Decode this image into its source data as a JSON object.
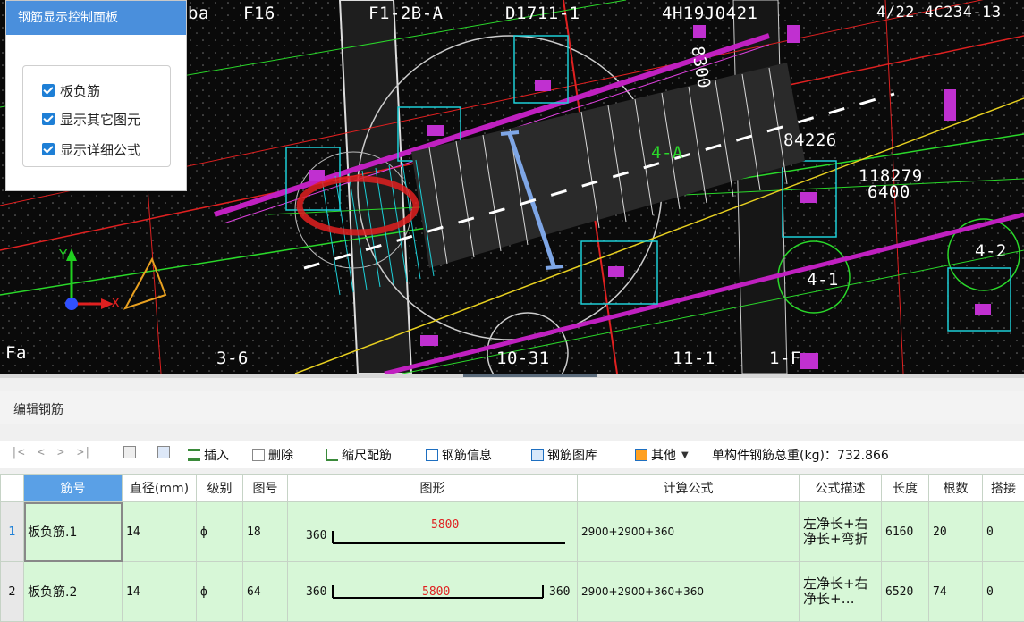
{
  "cad": {
    "labels": [
      "ba",
      "F16",
      "F1-2B-A",
      "D1711-1",
      "4H19J0421",
      "4/22-4C234-13",
      "8300",
      "84226",
      "4-A",
      "118279",
      "6400",
      "4-1",
      "4-2",
      "Fa",
      "3-6",
      "10-31",
      "11-1",
      "1-F"
    ],
    "axis_y": "Y",
    "axis_x": "X"
  },
  "control_panel": {
    "title": "钢筋显示控制面板",
    "options": [
      {
        "label": "板负筋",
        "checked": true
      },
      {
        "label": "显示其它图元",
        "checked": true
      },
      {
        "label": "显示详细公式",
        "checked": true
      }
    ]
  },
  "edit_panel": {
    "title": "编辑钢筋"
  },
  "toolbar": {
    "nav_first": "|<",
    "nav_prev": "<",
    "nav_next": ">",
    "nav_last": ">|",
    "insert": "插入",
    "delete": "删除",
    "scale_rebar": "缩尺配筋",
    "rebar_info": "钢筋信息",
    "rebar_library": "钢筋图库",
    "other": "其他",
    "total_weight": "单构件钢筋总重(kg)：732.866"
  },
  "grid": {
    "headers": [
      "筋号",
      "直径(mm)",
      "级别",
      "图号",
      "图形",
      "计算公式",
      "公式描述",
      "长度",
      "根数",
      "搭接"
    ],
    "rows": [
      {
        "num": "1",
        "name": "板负筋.1",
        "diameter": "14",
        "grade": "ф",
        "fig": "18",
        "shape_left": "360",
        "shape_mid": "5800",
        "shape_right": "",
        "formula": "2900+2900+360",
        "desc": "左净长+右净长+弯折",
        "length": "6160",
        "count": "20",
        "lap": "0"
      },
      {
        "num": "2",
        "name": "板负筋.2",
        "diameter": "14",
        "grade": "ф",
        "fig": "64",
        "shape_left": "360",
        "shape_mid": "5800",
        "shape_right": "360",
        "formula": "2900+2900+360+360",
        "desc": "左净长+右净长+…",
        "length": "6520",
        "count": "74",
        "lap": "0"
      }
    ]
  },
  "colors": {
    "accent": "#4a8fdc",
    "row_bg": "#d7f7d7",
    "shape_value": "#e02020"
  }
}
